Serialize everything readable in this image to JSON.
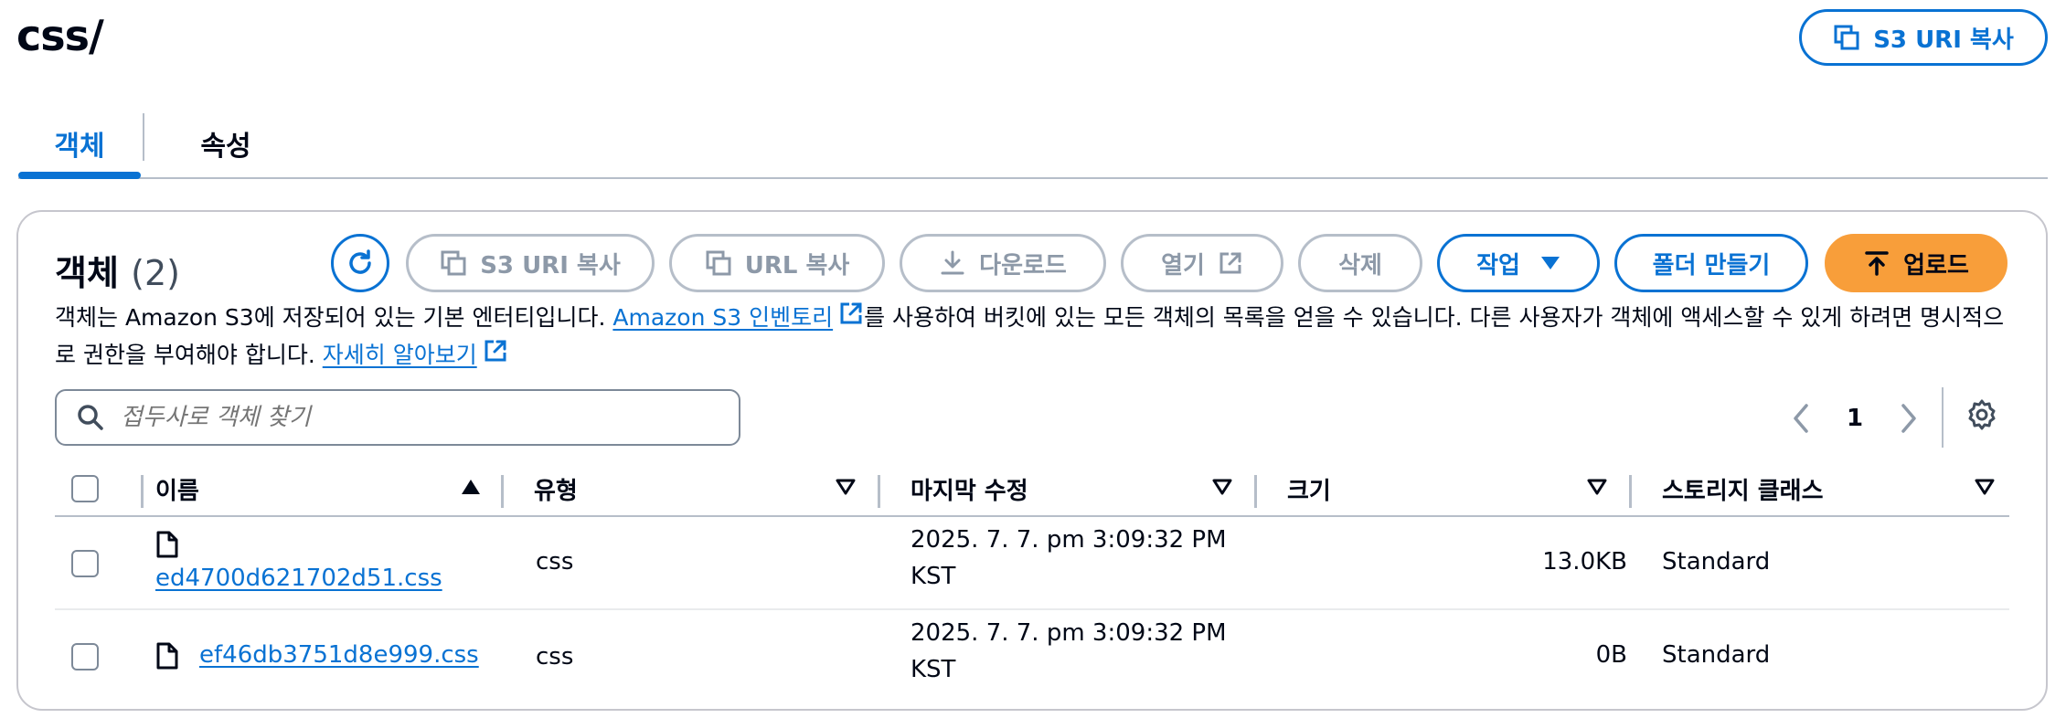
{
  "header": {
    "title": "css/",
    "copy_uri_label": "S3 URI 복사"
  },
  "tabs": [
    {
      "label": "객체",
      "active": true
    },
    {
      "label": "속성",
      "active": false
    }
  ],
  "objects_panel": {
    "title": "객체",
    "count": "(2)",
    "toolbar": {
      "copy_s3_uri": "S3 URI 복사",
      "copy_url": "URL 복사",
      "download": "다운로드",
      "open": "열기",
      "delete": "삭제",
      "actions": "작업",
      "create_folder": "폴더 만들기",
      "upload": "업로드"
    },
    "description": {
      "part1": "객체는 Amazon S3에 저장되어 있는 기본 엔터티입니다. ",
      "inventory_link": "Amazon S3 인벤토리",
      "part2": "를 사용하여 버킷에 있는 모든 객체의 목록을 얻을 수 있습니다. 다른 사용자가 객체에 액세스할 수 있게 하려면 명시적으로 권한을 부여해야 합니다. ",
      "learn_more_link": "자세히 알아보기"
    },
    "search": {
      "placeholder": "접두사로 객체 찾기",
      "value": ""
    },
    "pagination": {
      "current_page": "1"
    },
    "columns": [
      "이름",
      "유형",
      "마지막 수정",
      "크기",
      "스토리지 클래스"
    ],
    "rows": [
      {
        "name": "ed4700d621702d51.css",
        "type": "css",
        "modified_line1": "2025. 7. 7. pm 3:09:32 PM",
        "modified_line2": "KST",
        "size": "13.0KB",
        "storage_class": "Standard"
      },
      {
        "name": "ef46db3751d8e999.css",
        "type": "css",
        "modified_line1": "2025. 7. 7. pm 3:09:32 PM",
        "modified_line2": "KST",
        "size": "0B",
        "storage_class": "Standard"
      }
    ]
  },
  "colors": {
    "primary": "#0972d3",
    "upload": "#f89e3a",
    "disabled_border": "#b6bec9",
    "text": "#000716"
  }
}
